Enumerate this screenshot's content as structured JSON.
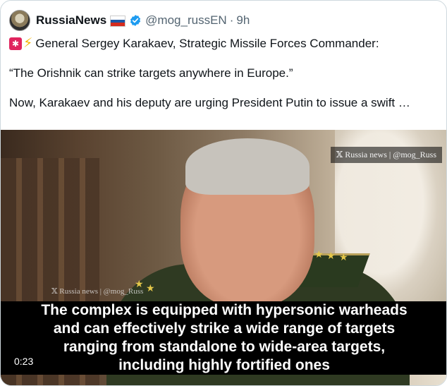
{
  "author": {
    "name": "RussiaNews",
    "handle": "@mog_russEN",
    "separator": "·",
    "time": "9h",
    "flag_icon": "russian-flag-icon",
    "verified_icon": "verified-badge-icon",
    "verified_color": "#1d9bf0"
  },
  "tweet": {
    "line1": "General Sergey Karakaev, Strategic Missile Forces Commander:",
    "line1_icons": [
      "siren-icon",
      "lightning-icon"
    ],
    "quote": "“The Orishnik can strike targets anywhere in Europe.”",
    "line3": "Now, Karakaev and his deputy are urging President Putin to issue a swift …"
  },
  "video": {
    "watermark_top": "𝕏 Russia news | @mog_Russ",
    "watermark_mid": "𝕏 Russia news | @mog_Russ",
    "subtitle_lines": [
      "The complex is equipped with hypersonic warheads",
      "and can effectively strike a wide range of targets",
      "ranging from standalone to wide-area targets,",
      "including highly fortified ones"
    ],
    "duration": "0:23"
  }
}
